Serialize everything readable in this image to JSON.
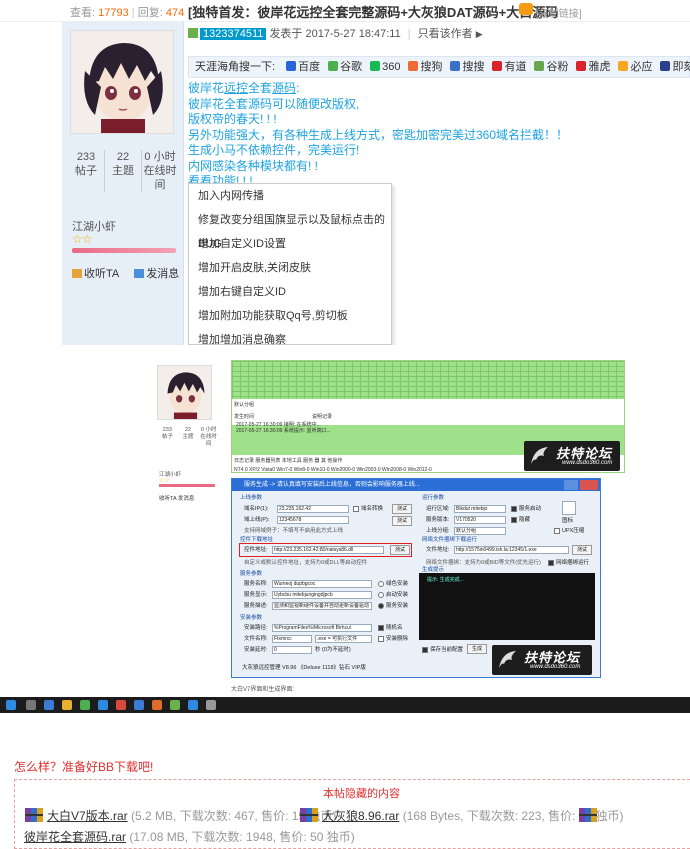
{
  "post": {
    "views_label": "查看:",
    "views": "17793",
    "replies_label": "回复:",
    "replies": "474",
    "title": "[独特首发：彼岸花远控全套完整源码+大灰狼DAT源码+大白源码",
    "copy_link": "[复制链接]",
    "author_id": "1323374511",
    "posted_at": "发表于 2017-5-27 18:47:11",
    "author_only": "只看该作者"
  },
  "profile": {
    "posts": "233",
    "posts_label": "帖子",
    "topics": "22",
    "topics_label": "主题",
    "online_hours": "0 小时",
    "online_label_1": "在线时",
    "online_label_2": "间",
    "username": "江湖小虾",
    "stars": "☆☆",
    "collect": "收听TA",
    "message": "发消息"
  },
  "search_bar": {
    "prefix": "天涯海角搜一下:",
    "engines": [
      {
        "label": "百度",
        "color": "#2b63d8"
      },
      {
        "label": "谷歌",
        "color": "#4caf50"
      },
      {
        "label": "360",
        "color": "#19b955"
      },
      {
        "label": "搜狗",
        "color": "#f06a36"
      },
      {
        "label": "搜搜",
        "color": "#3a70c8"
      },
      {
        "label": "有道",
        "color": "#d8232a"
      },
      {
        "label": "谷粉",
        "color": "#6aa84f"
      },
      {
        "label": "雅虎",
        "color": "#d8232a"
      },
      {
        "label": "必应",
        "color": "#f6a623"
      },
      {
        "label": "即刻",
        "color": "#2c3e8f"
      }
    ]
  },
  "body": {
    "line1_a": "彼岸花",
    "line1_b": "远控",
    "line1_c": "全套",
    "line1_d": "源码",
    "line1_e": ":",
    "line2": "彼岸花全套源码可以随便改版权,",
    "line3": "版权帝的春天! ! !",
    "line4": "另外功能强大，有各种生成上线方式，密匙加密完美过360域名拦截！！",
    "line5": "生成小马不依赖控件，完美运行!",
    "line6": "内网感染各种模块都有! !",
    "line7": "看看功能! ! !"
  },
  "feature_menu": [
    "加入内网传播",
    "修复改变分组国旗显示以及鼠标点击的BUG",
    "增加自定义ID设置",
    "增加开启皮肤,关闭皮肤",
    "增加右键自定义ID",
    "增加附加功能获取Qq号,剪切板",
    "增加增加消息确察"
  ],
  "screenshot": {
    "online_label": "默认分组",
    "log_header_time": "发生时间",
    "log_header_info": "说明记录",
    "log_rows": [
      {
        "time": "2017-05-27 16:30:09",
        "info": "接明: 在系统中..."
      },
      {
        "time": "2017-05-27 16:30:09",
        "info": "系统提示: 监听端口..."
      }
    ],
    "tabs": "日志记录  服务器列表  本地工具  服务 器  其 他操作",
    "status": "NT4.0 XP/2 Vista0 Win7-0 Win8-0 Win10-0 Win2000-0 Win2003-0 Win2008-0 Win2012-0",
    "gen_title": "服务生成 -> 请认真填写安装后上线信息，否则会影响服务器上线...",
    "sec_online": "上线参数",
    "domain_label": "域名IP(1):",
    "domain_value": "23.235.162.42",
    "port_label": "域上线(P):",
    "port_value": "12345678",
    "cb_domain": "域名转换",
    "btn_test": "测试",
    "hint_online": "支持网域例子：不填写不启用此方式上线",
    "sec_plugin": "控件下载地址",
    "plugin_label": "控件地址:",
    "plugin_value": "http://23.235.162.42:80/natsys86.dll",
    "plugin_hint": "自定义或默认控件地址，支持为0或DLL等启动控件",
    "sec_service": "服务参数",
    "svc_name_label": "服务名称:",
    "svc_name_value": "Wumeoj dupbgcoc",
    "svc_disp_label": "服务显示:",
    "svc_disp_value": "Uybcbu mitebjungingdjpcb",
    "svc_desc_label": "服务描述:",
    "svc_desc_value": "监测和监视新硬件设备并自动更新设备驱动",
    "opt_green": "绿色安装",
    "opt_start": "启动安装",
    "opt_service": "服务安装",
    "sec_install": "安装参数",
    "inst_path_label": "安装路径:",
    "inst_path_value": "%ProgramFiles%\\Microsoft Birhcu\\",
    "inst_file_label": "文件名称:",
    "inst_file_value": "Ftxmrcc",
    "inst_file_ext": ".exe  = 可执行文件",
    "inst_delay_label": "安装延时:",
    "inst_delay_value": "0",
    "inst_delay_unit": "秒 (0为不延时)",
    "cb_random": "随机名",
    "cb_install_del": "安装删除",
    "sec_run": "运行参数",
    "run_label": "运行区域:",
    "run_value": "Bikdut mitebjo",
    "ver_label": "服务版本:",
    "ver_value": "V170520",
    "grp_label": "上线分组:",
    "grp_value": "默认分组",
    "cb_startup": "服务启动",
    "cb_hide": "隐藏",
    "cb_icon": "图标",
    "cb_upx": "UPX压缩",
    "sec_download": "网络文件捆绑下载运行",
    "file_label": "文件地址:",
    "file_value": "http://1575in0499.ish.la:12345/1.exe",
    "file_hint": "网络文件捆绑：支持为0或BID等文件(优先运行)",
    "cb_bundle": "网络捆绑运行",
    "sec_gen": "生成提示",
    "gen_msg": "提示: 生成完成...",
    "cb_save": "保存当前配置",
    "btn_generate": "生成",
    "footer": "大灰狼远控管理 V8.96 《Deluxe 1118》钻石 VIP版",
    "logo_text": "扶特论坛",
    "logo_url": "www.dsdo360.com",
    "caption": "大白V7界面和生成界面:"
  },
  "downloads": {
    "ready": "怎么样？准备好BB下载吧!",
    "hidden_title": "本帖隐藏的内容",
    "files": [
      {
        "name": "大白V7版本.rar",
        "meta": "(5.2 MB, 下载次数: 467, 售价: 15 独币)"
      },
      {
        "name": "大灰狼8.96.rar",
        "meta": "(168 Bytes, 下载次数: 223, 售价: 15 独币)"
      },
      {
        "name": "彼岸花全套源码.rar",
        "meta": "(17.08 MB, 下载次数: 1948, 售价: 50 独币)"
      }
    ]
  }
}
